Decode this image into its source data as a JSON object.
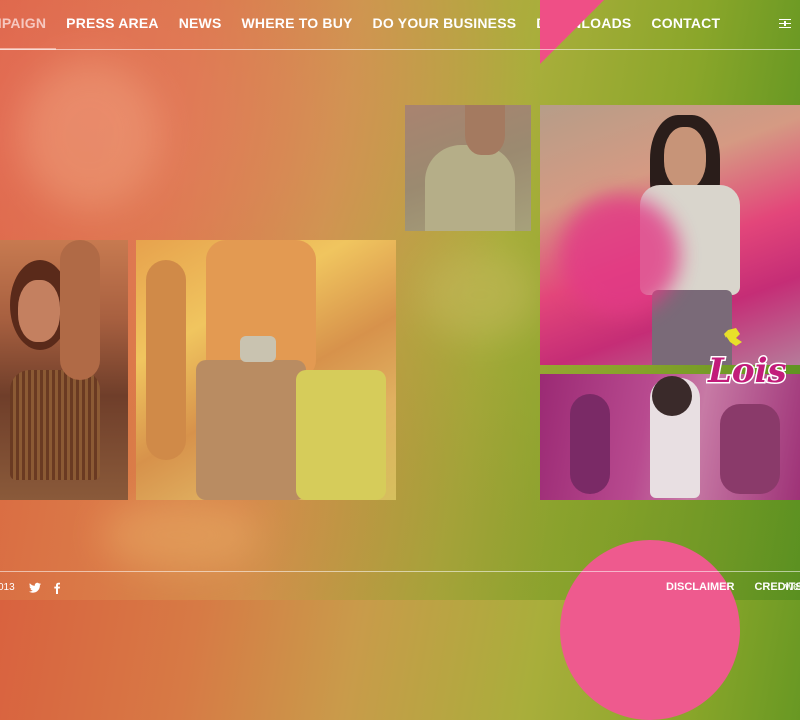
{
  "nav": {
    "items": [
      {
        "label": "MPAIGN",
        "active": true
      },
      {
        "label": "PRESS AREA"
      },
      {
        "label": "NEWS"
      },
      {
        "label": "WHERE TO BUY"
      },
      {
        "label": "DO YOUR BUSINESS"
      },
      {
        "label": "DOWNLOADS"
      },
      {
        "label": "CONTACT"
      }
    ],
    "menu_icon": "menu-icon"
  },
  "brand": {
    "logo_text": "Lois",
    "accent_pink": "#ee5a8e",
    "logo_yellow": "#e8e02a"
  },
  "footer": {
    "copyright": "013",
    "social": [
      "twitter-icon",
      "facebook-icon"
    ],
    "links": [
      "DISCLAIMER",
      "CREDITS"
    ],
    "web_text": "web"
  },
  "tiles": [
    {
      "icon": "photo-woman-fringe"
    },
    {
      "icon": "photo-couple-jeans"
    },
    {
      "icon": "photo-man-torso"
    },
    {
      "icon": "photo-woman-headband-powder"
    },
    {
      "icon": "photo-woman-group-pink"
    }
  ]
}
